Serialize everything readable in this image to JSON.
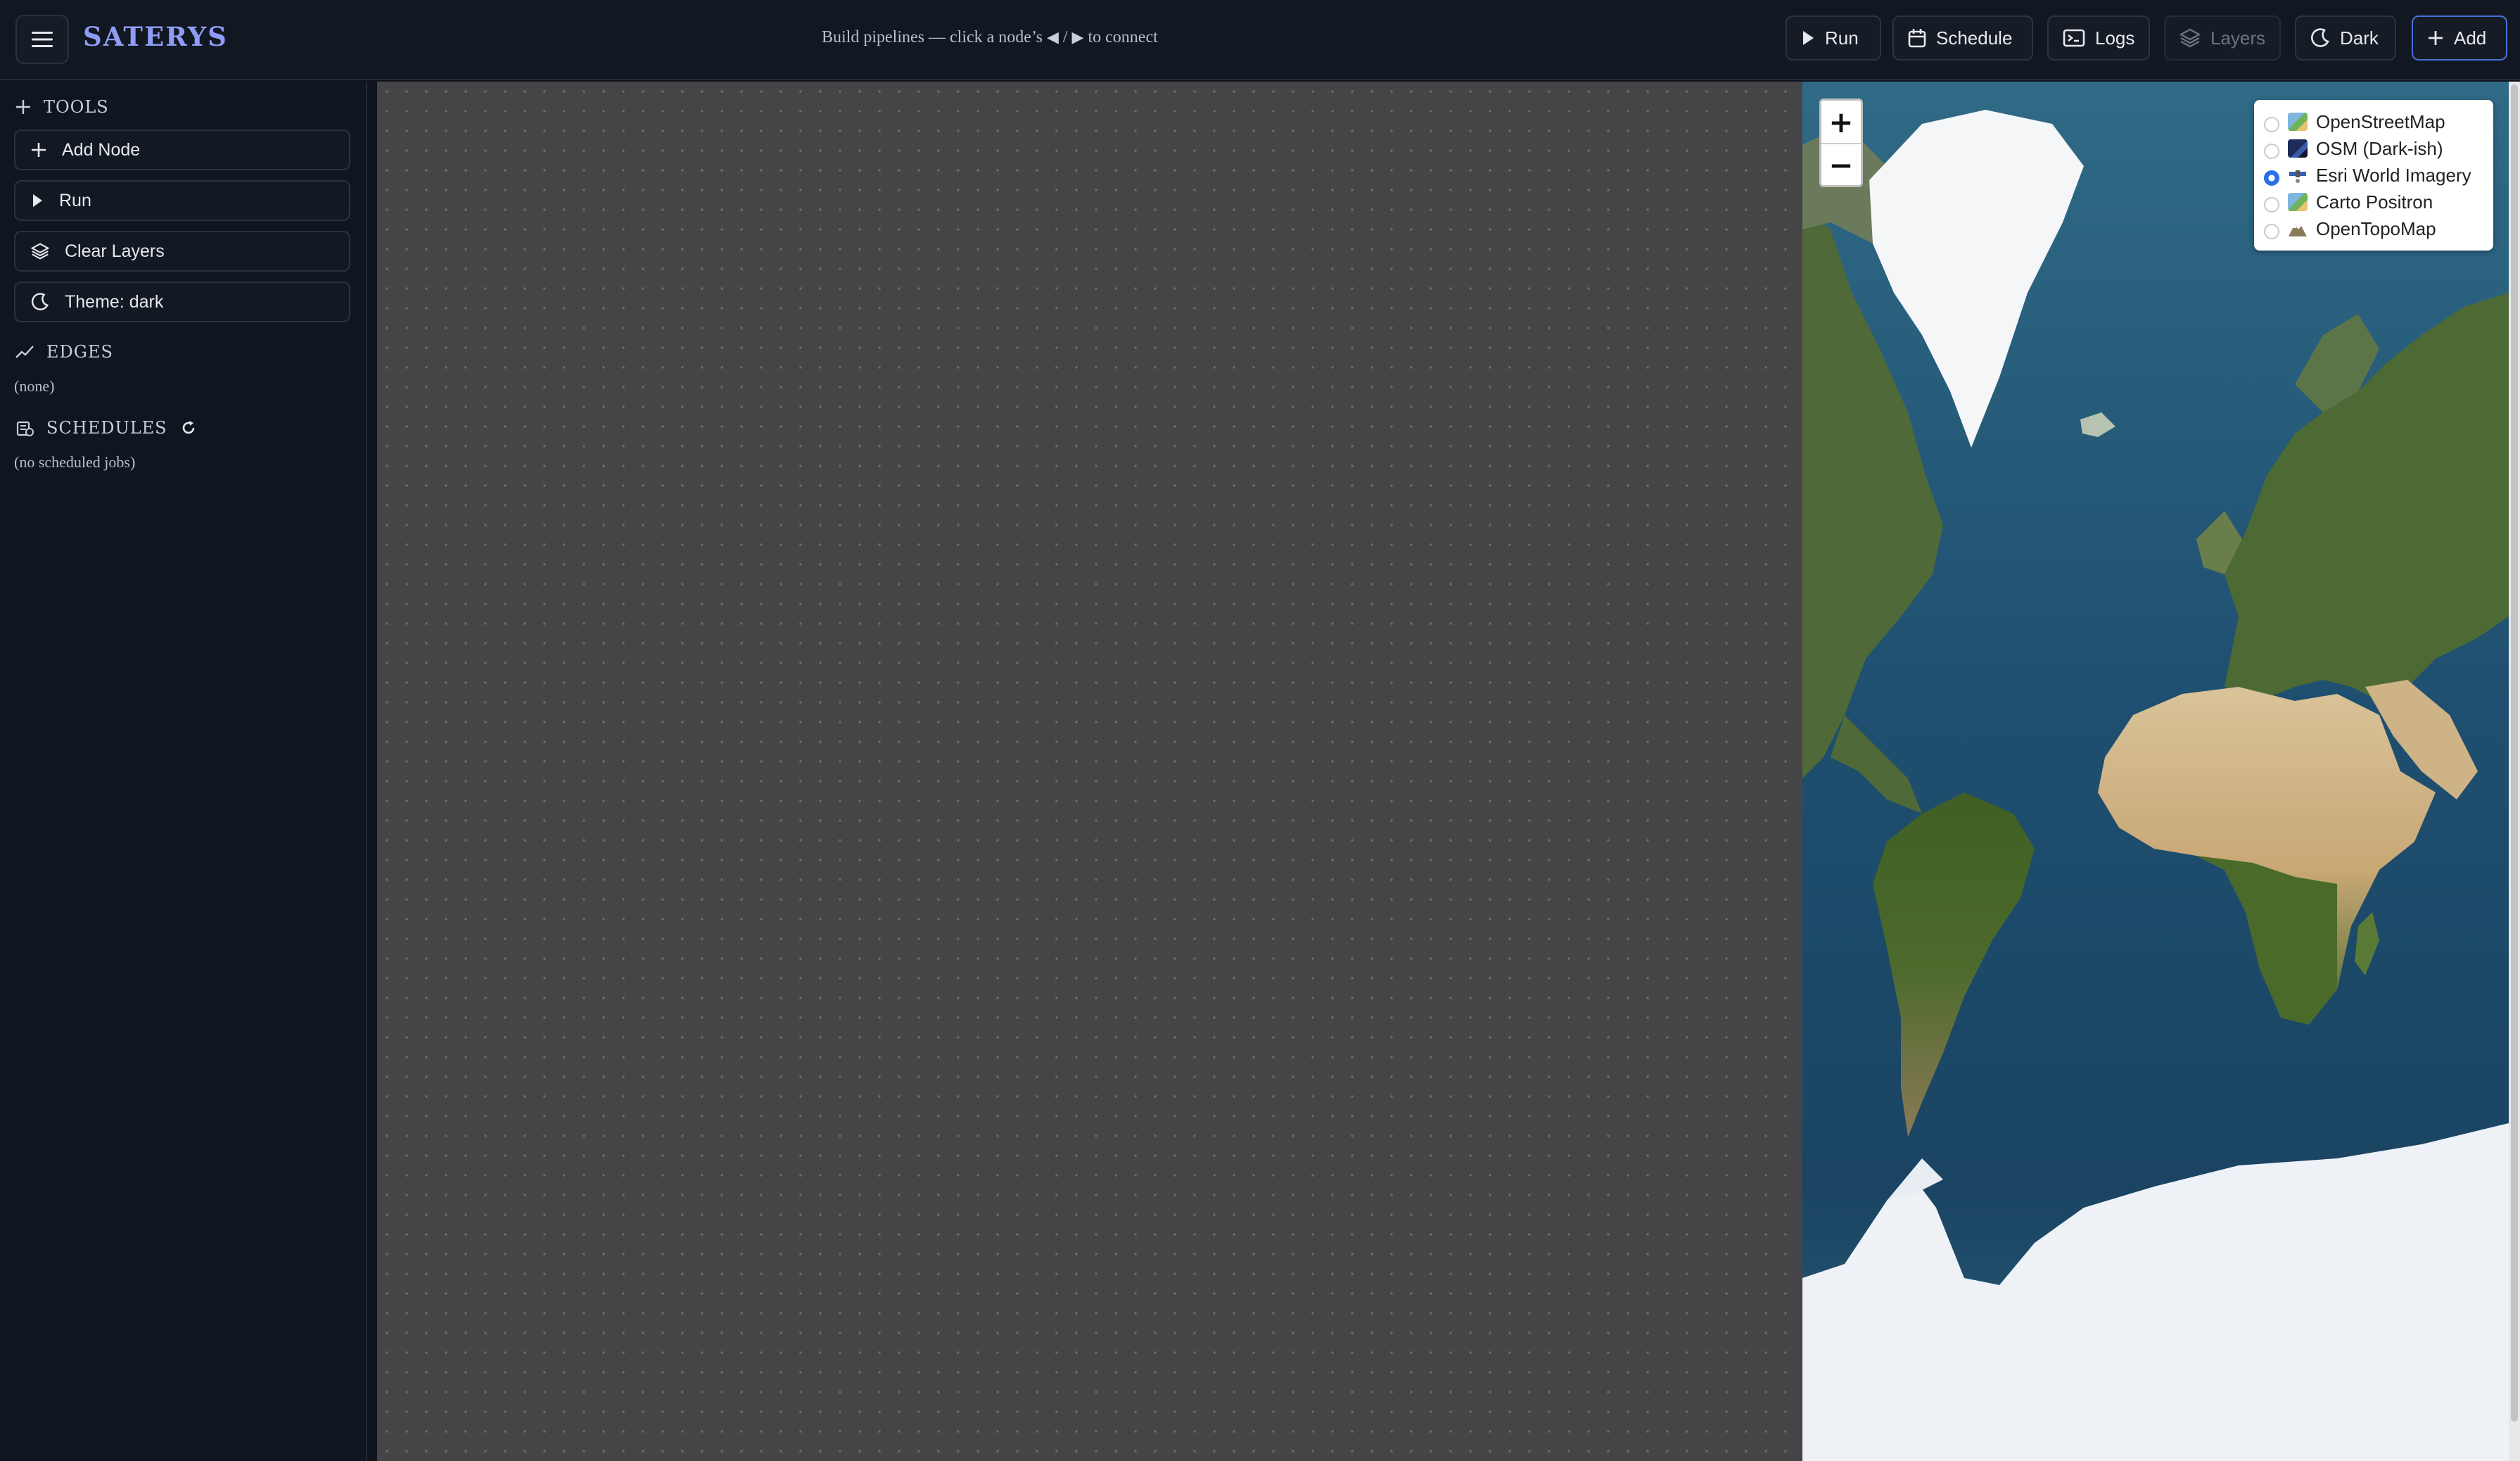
{
  "app": {
    "brand": "SATERYS",
    "hint_prefix": "Build pipelines — click a node’s",
    "hint_sep": "/",
    "hint_suffix": "to connect"
  },
  "toolbar": {
    "run_label": "Run",
    "schedule_label": "Schedule",
    "logs_label": "Logs",
    "layers_label": "Layers",
    "dark_label": "Dark",
    "add_label": "Add"
  },
  "sidebar": {
    "tools_title": "TOOLS",
    "tools": [
      {
        "label": "Add Node",
        "icon": "plus-icon"
      },
      {
        "label": "Run",
        "icon": "play-icon"
      },
      {
        "label": "Clear Layers",
        "icon": "layers-icon"
      },
      {
        "label": "Theme: dark",
        "icon": "moon-icon"
      }
    ],
    "edges_title": "EDGES",
    "edges_empty": "(none)",
    "schedules_title": "SCHEDULES",
    "schedules_empty": "(no scheduled jobs)"
  },
  "map": {
    "zoom_in": "+",
    "zoom_out": "−",
    "basemaps": [
      {
        "label": "OpenStreetMap",
        "selected": false,
        "icon": "map-emoji-icon"
      },
      {
        "label": "OSM (Dark-ish)",
        "selected": false,
        "icon": "night-map-emoji-icon"
      },
      {
        "label": "Esri World Imagery",
        "selected": true,
        "icon": "satellite-emoji-icon"
      },
      {
        "label": "Carto Positron",
        "selected": false,
        "icon": "map-emoji-icon"
      },
      {
        "label": "OpenTopoMap",
        "selected": false,
        "icon": "mountain-emoji-icon"
      }
    ]
  },
  "colors": {
    "brand": "#8d9cf5",
    "accent": "#4b6fd8",
    "canvas": "#454548",
    "background": "#101620"
  }
}
